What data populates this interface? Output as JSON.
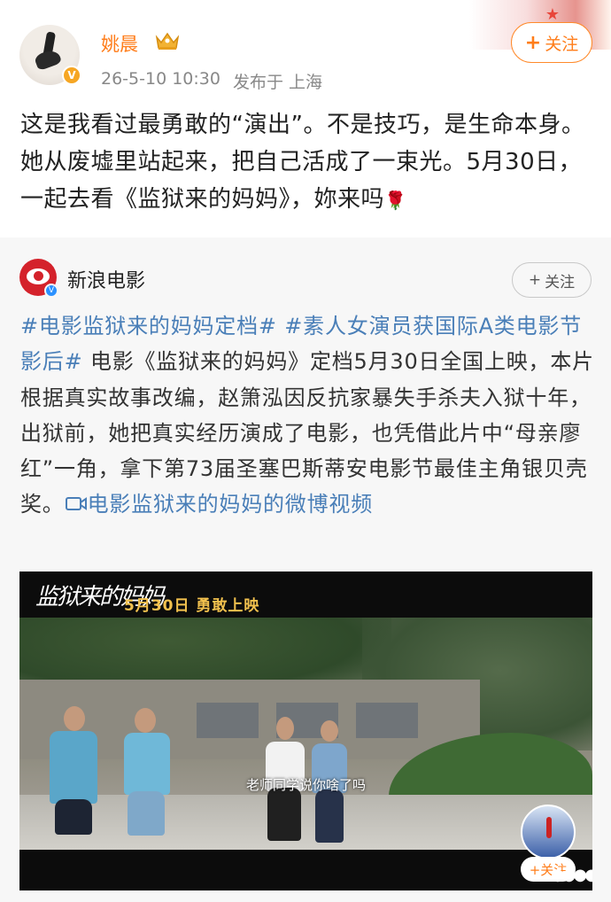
{
  "author": {
    "name": "姚晨",
    "timestamp": "26-5-10 10:30",
    "location": "发布于 上海",
    "follow_label": "关注",
    "follow_plus": "+"
  },
  "post": {
    "text": "这是我看过最勇敢的“演出”。不是技巧，是生命本身。她从废墟里站起来，把自己活成了一束光。5月30日，一起去看《监狱来的妈妈》，妳来吗",
    "emoji": "🌹"
  },
  "repost": {
    "author": "新浪电影",
    "follow_label": "关注",
    "follow_plus": "+",
    "hashtag_1": "#电影监狱来的妈妈定档#",
    "hashtag_2": "#素人女演员获国际A类电影节影后#",
    "body": " 电影《监狱来的妈妈》定档5月30日全国上映，本片根据真实故事改编，赵箫泓因反抗家暴失手杀夫入狱十年，出狱前，她把真实经历演成了电影，也凭借此片中“母亲廖红”一角，拿下第73届圣塞巴斯蒂安电影节最佳主角银贝壳奖。",
    "video_link": "电影监狱来的妈妈的微博视频"
  },
  "video": {
    "logo_text": "监狱来的妈妈",
    "date_text": "5月30日  勇敢上映",
    "subtitle": "老师同学说你啥了吗",
    "mini_follow": "+关注"
  },
  "colors": {
    "accent": "#ff7d1a",
    "link": "#4a7fb8",
    "card_bg": "#f7f7f7"
  }
}
